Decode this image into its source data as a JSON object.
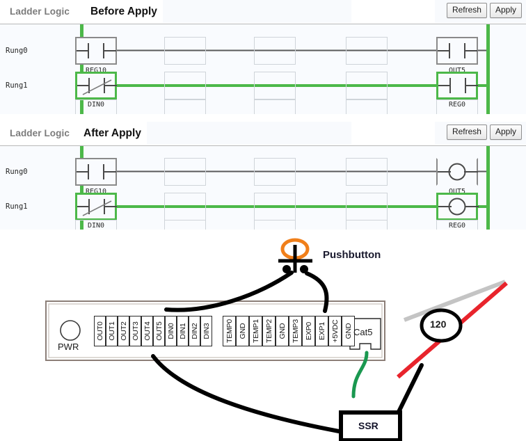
{
  "panels": [
    {
      "tab_ladder": "Ladder Logic",
      "tab_state": "Before Apply",
      "refresh_label": "Refresh",
      "apply_label": "Apply",
      "rungs": [
        {
          "label": "Rung0",
          "energized": false,
          "input": {
            "name": "REG10",
            "type": "contact-no",
            "energized": false
          },
          "output": {
            "name": "OUT5",
            "type": "contact-no",
            "energized": false
          }
        },
        {
          "label": "Rung1",
          "energized": true,
          "input": {
            "name": "DIN0",
            "type": "contact-nc",
            "energized": true
          },
          "output": {
            "name": "REG0",
            "type": "contact-no",
            "energized": true
          }
        }
      ]
    },
    {
      "tab_ladder": "Ladder Logic",
      "tab_state": "After Apply",
      "refresh_label": "Refresh",
      "apply_label": "Apply",
      "rungs": [
        {
          "label": "Rung0",
          "energized": false,
          "input": {
            "name": "REG10",
            "type": "contact-no",
            "energized": false
          },
          "output": {
            "name": "OUT5",
            "type": "coil",
            "energized": false
          }
        },
        {
          "label": "Rung1",
          "energized": true,
          "input": {
            "name": "DIN0",
            "type": "contact-nc",
            "energized": true
          },
          "output": {
            "name": "REG0",
            "type": "coil",
            "energized": true
          }
        }
      ]
    }
  ],
  "wiring": {
    "pushbutton_label": "Pushbutton",
    "pwr_label": "PWR",
    "cat5_label": "Cat5",
    "ssr_label": "SSR",
    "mains_label": "120",
    "terminals_block_a": [
      "OUT0",
      "OUT1",
      "OUT2",
      "OUT3",
      "OUT4",
      "OUT5",
      "DIN0",
      "DIN1",
      "DIN2",
      "DIN3"
    ],
    "terminals_block_b": [
      "TEMP0",
      "GND",
      "TEMP1",
      "TEMP2",
      "GND",
      "TEMP3",
      "EXP0",
      "EXP1",
      "+5VDC",
      "GND"
    ],
    "colors": {
      "rail_green": "#4cb849",
      "wire_black": "#000000",
      "wire_green": "#1a9850",
      "wire_red": "#e8242c",
      "wire_gray": "#c4c4c4",
      "pushbutton_orange": "#f07f1a",
      "board_outline": "#8c7f78"
    }
  }
}
